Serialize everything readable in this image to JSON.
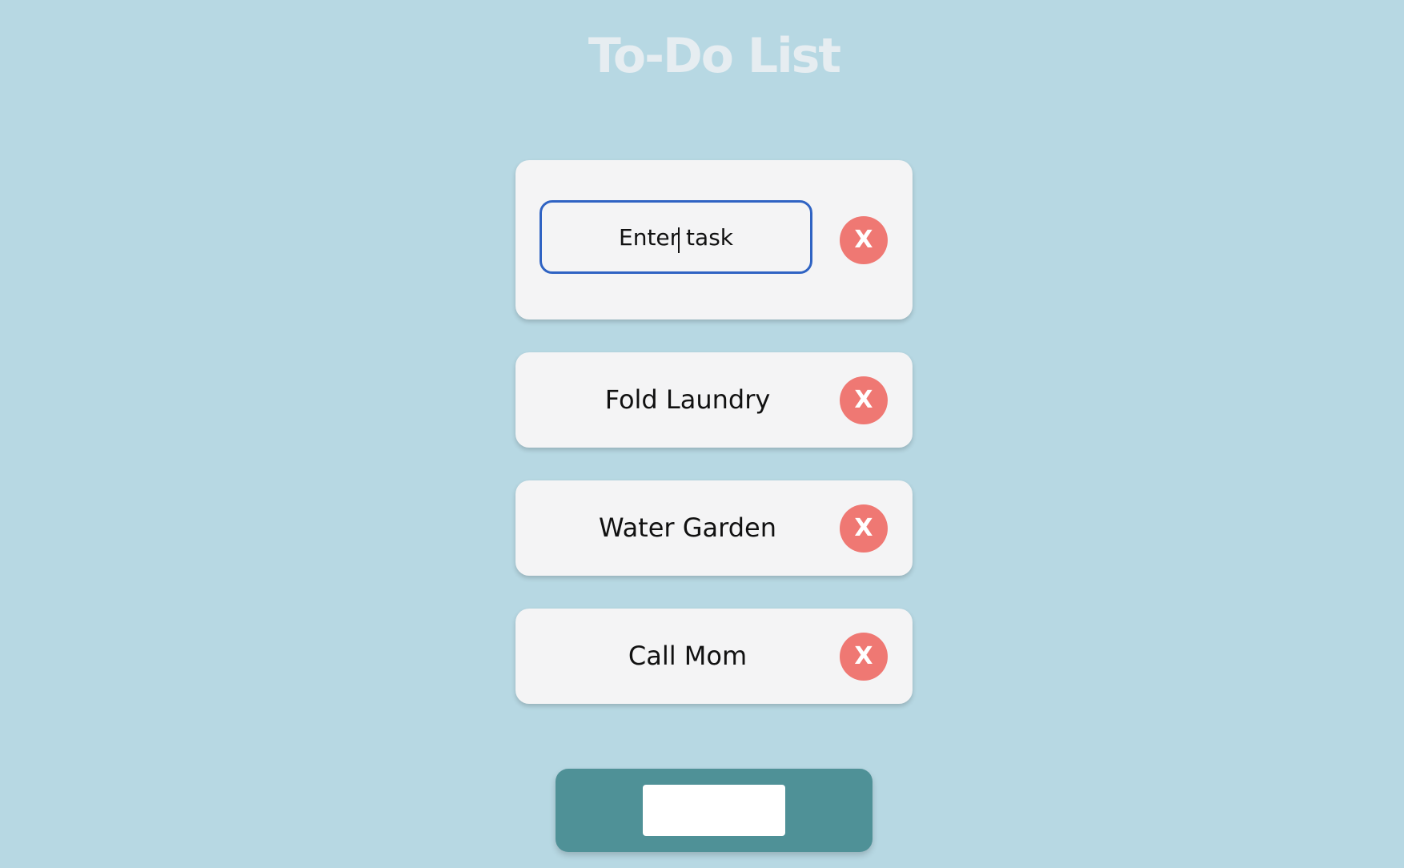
{
  "app": {
    "title": "To-Do List"
  },
  "new_task": {
    "placeholder": "Enter task",
    "value": "",
    "delete_label": "X"
  },
  "tasks": [
    {
      "label": "Fold Laundry",
      "delete_label": "X"
    },
    {
      "label": "Water Garden",
      "delete_label": "X"
    },
    {
      "label": "Call Mom",
      "delete_label": "X"
    }
  ],
  "add_button": {
    "label": ""
  },
  "colors": {
    "background": "#b7d8e3",
    "card": "#f4f4f5",
    "delete": "#ef7873",
    "input_border": "#2f63c3",
    "panel": "#4f9197"
  }
}
